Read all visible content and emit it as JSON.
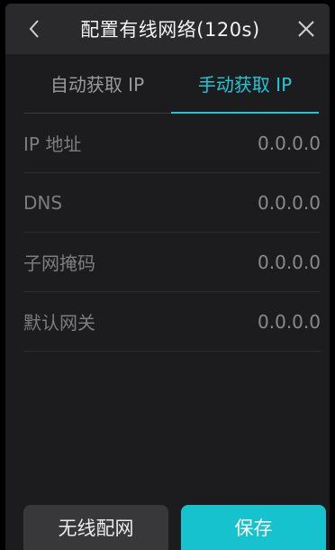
{
  "header": {
    "title": "配置有线网络(120s)",
    "back_icon": "chevron-left-icon",
    "close_icon": "close-icon"
  },
  "tabs": [
    {
      "label": "自动获取 IP",
      "active": false
    },
    {
      "label": "手动获取 IP",
      "active": true
    }
  ],
  "fields": [
    {
      "label": "IP 地址",
      "value": "0.0.0.0"
    },
    {
      "label": "DNS",
      "value": "0.0.0.0"
    },
    {
      "label": "子网掩码",
      "value": "0.0.0.0"
    },
    {
      "label": "默认网关",
      "value": "0.0.0.0"
    }
  ],
  "footer": {
    "wireless_label": "无线配网",
    "save_label": "保存"
  },
  "colors": {
    "accent": "#1ec8d6",
    "background": "#1c1c1e",
    "header": "#2a2a2c"
  }
}
